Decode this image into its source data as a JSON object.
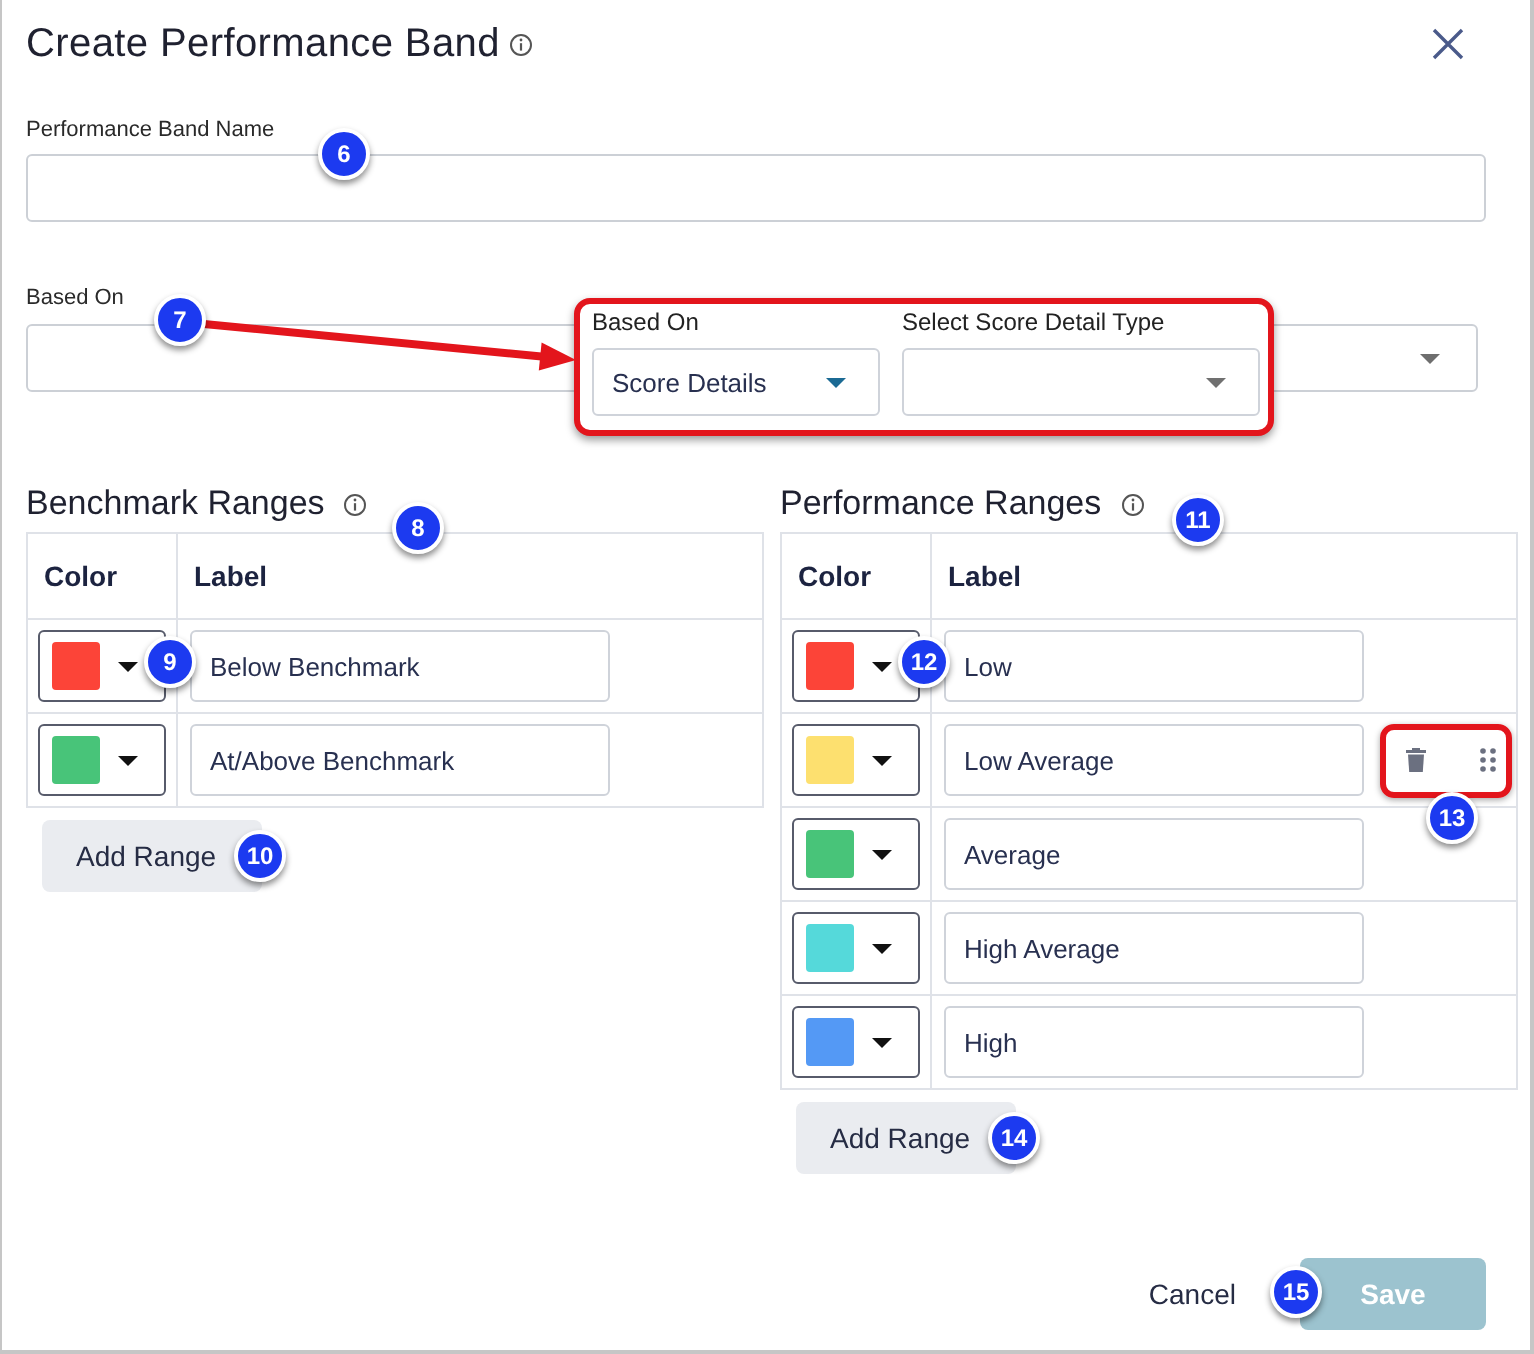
{
  "dialog": {
    "title": "Create Performance Band"
  },
  "name_field": {
    "label": "Performance Band Name",
    "badge": "6"
  },
  "based_on_field": {
    "label": "Based On",
    "badge": "7"
  },
  "callout": {
    "fields": [
      {
        "label": "Based On",
        "value": "Score Details",
        "focused": true
      },
      {
        "label": "Select Score Detail Type",
        "focused": false
      }
    ]
  },
  "benchmark_ranges": {
    "title": "Benchmark Ranges",
    "badge": "8",
    "columns": [
      "Color",
      "Label"
    ],
    "rows": [
      {
        "color": "#fc4438",
        "label": "Below Benchmark",
        "picker_badge": "9"
      },
      {
        "color": "#48c479",
        "label": "At/Above Benchmark"
      }
    ],
    "add_button": {
      "label": "Add Range",
      "badge": "10"
    }
  },
  "performance_ranges": {
    "title": "Performance Ranges",
    "badge": "11",
    "columns": [
      "Color",
      "Label"
    ],
    "rows": [
      {
        "color": "#fc4438",
        "label": "Low",
        "picker_badge": "12",
        "hovered": false
      },
      {
        "color": "#fde06f",
        "label": "Low Average",
        "hovered": true,
        "actions_badge": "13"
      },
      {
        "color": "#48c479",
        "label": "Average",
        "hovered": false
      },
      {
        "color": "#55d9da",
        "label": "High Average",
        "hovered": false
      },
      {
        "color": "#5499f5",
        "label": "High",
        "hovered": false
      }
    ],
    "add_button": {
      "label": "Add Range",
      "badge": "14"
    }
  },
  "footer": {
    "cancel": "Cancel",
    "save": {
      "label": "Save",
      "disabled": true,
      "badge": "15"
    }
  }
}
